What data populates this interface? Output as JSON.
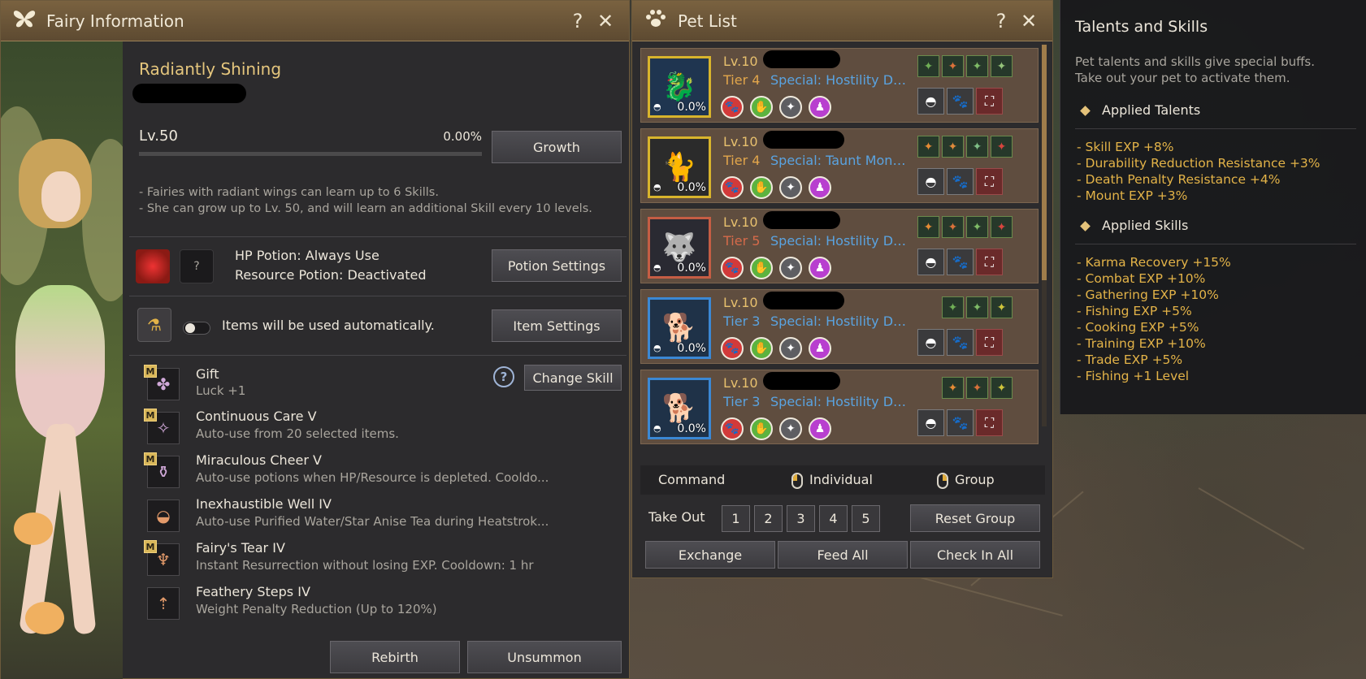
{
  "fairy_window": {
    "title": "Fairy Information",
    "help_label": "?",
    "close_label": "✕",
    "fairy_name": "Radiantly Shining",
    "level_label": "Lv.50",
    "exp_percent": "0.00%",
    "exp_progress": 0,
    "growth_button": "Growth",
    "description_lines": [
      "- Fairies with radiant wings can learn up to 6 Skills.",
      "- She can grow up to Lv. 50, and will learn an additional Skill every 10 levels."
    ],
    "hp_potion_text": "HP Potion: Always Use",
    "resource_potion_text": "Resource Potion: Deactivated",
    "unknown_slot_label": "?",
    "potion_settings_button": "Potion Settings",
    "auto_items_text": "Items will be used automatically.",
    "item_settings_button": "Item Settings",
    "change_skill_button": "Change Skill",
    "skills": [
      {
        "badge": "M",
        "name": "Gift",
        "desc": "Luck +1",
        "icon": "clover-icon"
      },
      {
        "badge": "M",
        "name": "Continuous Care V",
        "desc": "Auto-use from 20 selected items.",
        "icon": "fairy-icon"
      },
      {
        "badge": "M",
        "name": "Miraculous Cheer V",
        "desc": "Auto-use potions when HP/Resource is depleted. Cooldo...",
        "icon": "potion-cheer-icon"
      },
      {
        "badge": "",
        "name": "Inexhaustible Well IV",
        "desc": "Auto-use Purified Water/Star Anise Tea during Heatstrok...",
        "icon": "well-bowl-icon"
      },
      {
        "badge": "M",
        "name": "Fairy's Tear IV",
        "desc": "Instant Resurrection without losing EXP. Cooldown: 1 hr",
        "icon": "tear-vase-icon"
      },
      {
        "badge": "",
        "name": "Feathery Steps IV",
        "desc": "Weight Penalty Reduction (Up to 120%)",
        "icon": "weight-bag-icon"
      }
    ],
    "rebirth_button": "Rebirth",
    "unsummon_button": "Unsummon"
  },
  "pet_window": {
    "title": "Pet List",
    "help_label": "?",
    "close_label": "✕",
    "pets": [
      {
        "level": "Lv.10",
        "tier": "Tier 4",
        "tier_color": "#e2a64b",
        "special": "Special: Hostility Det...",
        "hunger": "0.0%",
        "frame_color": "#d8b42c",
        "portrait": "🐉",
        "portrait_bg": "#1f3550",
        "talents": [
          "#6fae55",
          "#d9713a",
          "#7ebb67",
          "#94c27a"
        ]
      },
      {
        "level": "Lv.10",
        "tier": "Tier 4",
        "tier_color": "#e2a64b",
        "special": "Special: Taunt Mons...",
        "hunger": "0.0%",
        "frame_color": "#d8b42c",
        "portrait": "🐈",
        "portrait_bg": "#2b2b2b",
        "talents": [
          "#e58b35",
          "#e08a3c",
          "#7fbf86",
          "#d6453e"
        ]
      },
      {
        "level": "Lv.10",
        "tier": "Tier 5",
        "tier_color": "#d56a4a",
        "special": "Special: Hostility Det...",
        "hunger": "0.0%",
        "frame_color": "#c55d44",
        "portrait": "🐺",
        "portrait_bg": "#2a2a32",
        "talents": [
          "#e58b35",
          "#d9713a",
          "#7ebb67",
          "#d6453e"
        ]
      },
      {
        "level": "Lv.10",
        "tier": "Tier 3",
        "tier_color": "#5aa3e0",
        "special": "Special: Hostility Det...",
        "hunger": "0.0%",
        "frame_color": "#3b88d4",
        "portrait": "🐕",
        "portrait_bg": "#1f3248",
        "talents": [
          "#6fae55",
          "#7ebb67",
          "#cfc53c"
        ]
      },
      {
        "level": "Lv.10",
        "tier": "Tier 3",
        "tier_color": "#5aa3e0",
        "special": "Special: Hostility Det...",
        "hunger": "0.0%",
        "frame_color": "#3b88d4",
        "portrait": "🐕",
        "portrait_bg": "#1f3248",
        "talents": [
          "#e58b35",
          "#d9713a",
          "#cfc53c"
        ]
      }
    ],
    "command_label": "Command",
    "individual_label": "Individual",
    "group_label": "Group",
    "take_out_label": "Take Out",
    "group_numbers": [
      "1",
      "2",
      "3",
      "4",
      "5"
    ],
    "reset_group_button": "Reset Group",
    "exchange_button": "Exchange",
    "feed_all_button": "Feed All",
    "check_in_all_button": "Check In All"
  },
  "talents_panel": {
    "title": "Talents and Skills",
    "subtitle_lines": [
      "Pet talents and skills give special buffs.",
      "Take out your pet to activate them."
    ],
    "applied_talents_header": "Applied Talents",
    "talents": [
      "- Skill EXP +8%",
      "- Durability Reduction Resistance +3%",
      "- Death Penalty Resistance +4%",
      "- Mount EXP +3%"
    ],
    "applied_skills_header": "Applied Skills",
    "skills": [
      "- Karma Recovery +15%",
      "- Combat EXP +10%",
      "- Gathering EXP +10%",
      "- Fishing EXP +5%",
      "- Cooking EXP +5%",
      "- Training EXP +10%",
      "- Trade EXP +5%",
      "- Fishing +1 Level"
    ]
  }
}
